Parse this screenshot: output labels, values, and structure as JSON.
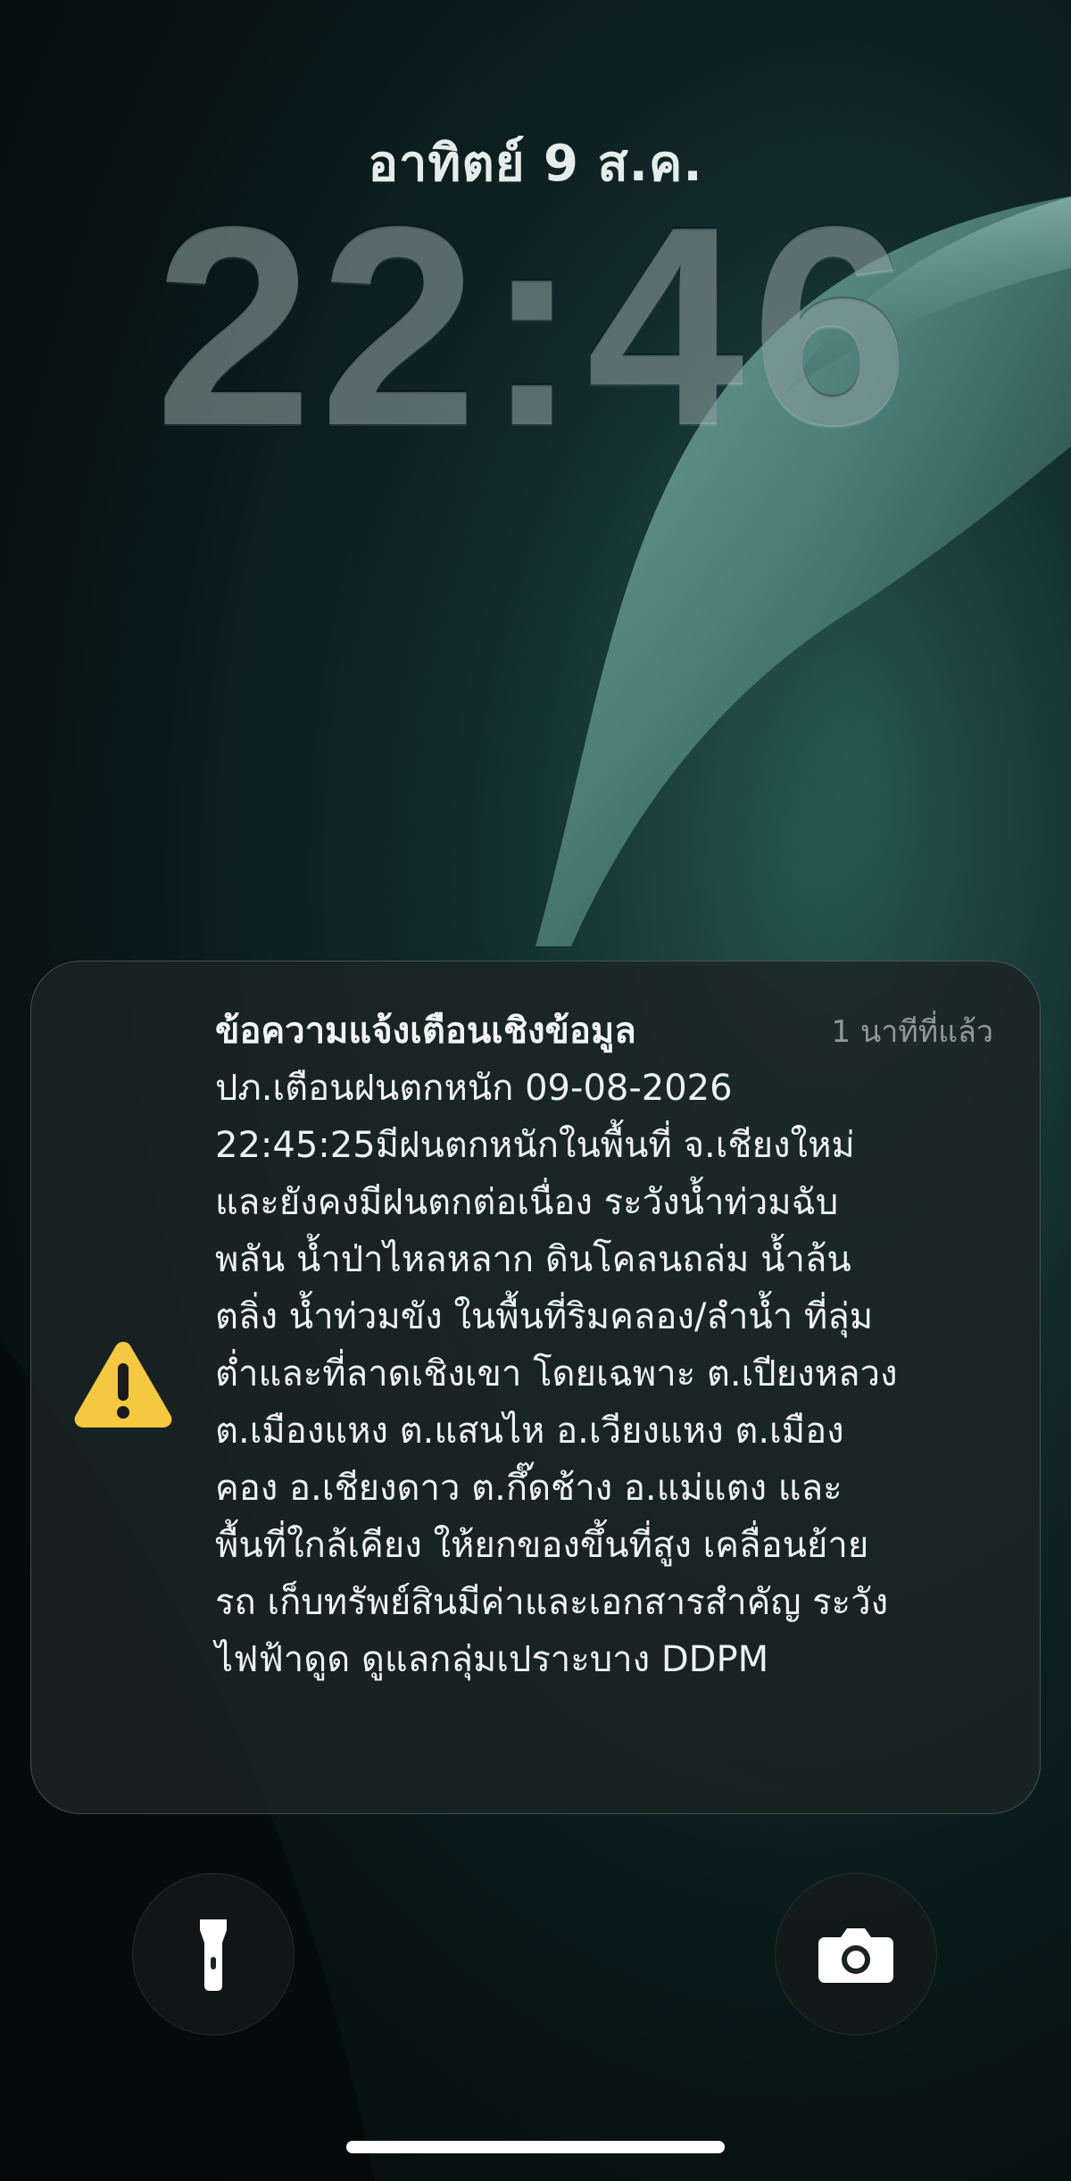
{
  "lock_screen": {
    "date": "อาทิตย์ 9 ส.ค.",
    "time": "22:46"
  },
  "notification": {
    "title": "ข้อความแจ้งเตือนเชิงข้อมูล",
    "timestamp": "1 นาทีที่แล้ว",
    "body": "ปภ.เตือนฝนตกหนัก  09-08-2026\n22:45:25มีฝนตกหนักในพื้นที่ จ.เชียงใหม่\nและยังคงมีฝนตกต่อเนื่อง ระวังน้ำท่วมฉับ\nพลัน น้ำป่าไหลหลาก ดินโคลนถล่ม น้ำล้น\nตลิ่ง น้ำท่วมขัง ในพื้นที่ริมคลอง/ลำน้ำ ที่ลุ่ม\nต่ำและที่ลาดเชิงเขา โดยเฉพาะ ต.เปียงหลวง\nต.เมืองแหง ต.แสนไห อ.เวียงแหง ต.เมือง\nคอง อ.เชียงดาว ต.กึ๊ดช้าง อ.แม่แตง และ\nพื้นที่ใกล้เคียง ให้ยกของขึ้นที่สูง เคลื่อนย้าย\nรถ เก็บทรัพย์สินมีค่าและเอกสารสำคัญ ระวัง\nไฟฟ้าดูด ดูแลกลุ่มเปราะบาง DDPM",
    "icon": "warning-triangle-icon",
    "icon_color": "#F5C842"
  },
  "actions": {
    "flashlight_icon": "flashlight-icon",
    "camera_icon": "camera-icon"
  },
  "colors": {
    "background_dark": "#07100F",
    "wallpaper_accent": "#6FA39C"
  }
}
